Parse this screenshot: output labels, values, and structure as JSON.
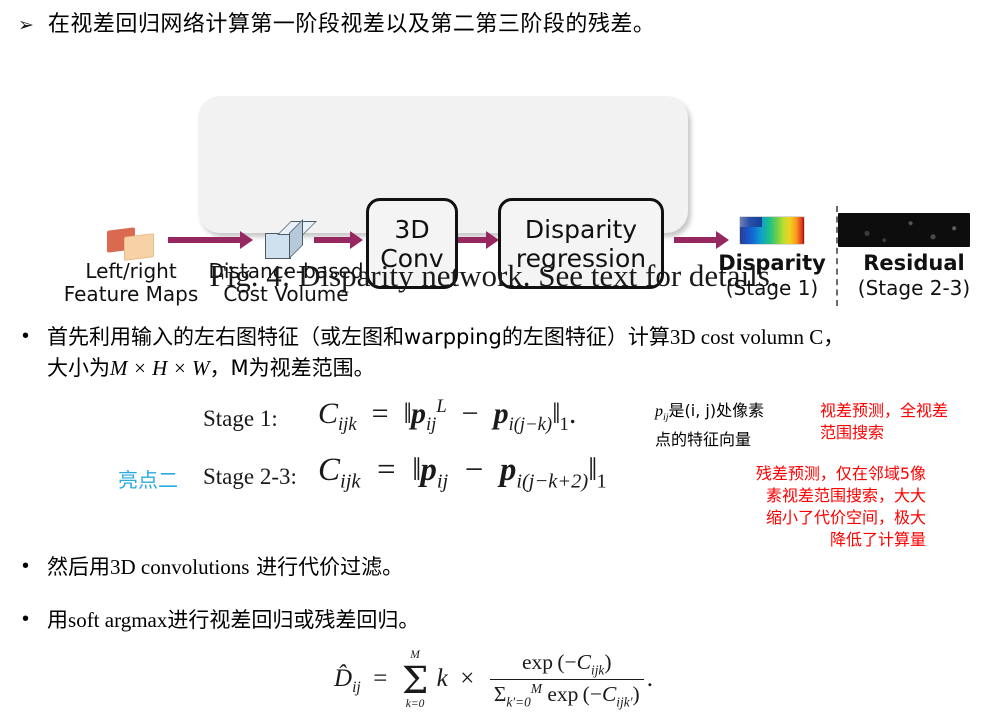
{
  "slide": {
    "heading_bullet_glyph": "➢",
    "heading": "在视差回归网络计算第一阶段视差以及第二第三阶段的残差。"
  },
  "figure": {
    "caption": "Fig. 4: Disparity network. See text for details.",
    "input": {
      "icon": "feature-maps-icon",
      "label_line1": "Left/right",
      "label_line2": "Feature Maps"
    },
    "cost_volume": {
      "icon": "cube-icon",
      "label_line1": "Distance-based",
      "label_line2": "Cost Volume"
    },
    "nodes": [
      {
        "id": "3d-conv",
        "line1": "3D",
        "line2": "Conv"
      },
      {
        "id": "disparity-regression",
        "line1": "Disparity",
        "line2": "regression"
      }
    ],
    "outputs": [
      {
        "id": "disparity",
        "title": "Disparity",
        "stage": "(Stage 1)"
      },
      {
        "id": "residual",
        "title": "Residual",
        "stage": "(Stage 2-3)"
      }
    ],
    "arrow_color": "#96275f",
    "panel_color": "#f2f2f2"
  },
  "bullets": {
    "b1_part1": "首先利用输入的左右图特征（或左图和warpping的左图特征）计算",
    "b1_part2": "3D cost volumn C",
    "b1_part3": "，",
    "b1_line2_a": "大小为",
    "b1_line2_math": "M × H × W",
    "b1_line2_b": "，M为视差范围。",
    "b2_a": "然后用",
    "b2_b": "3D convolutions",
    "b2_c": " 进行代价过滤。",
    "b3_a": "用",
    "b3_b": "soft argmax",
    "b3_c": "进行视差回归或残差回归。",
    "dot": "•"
  },
  "equations": {
    "stage1_label": "Stage 1:",
    "stage23_label": "Stage 2-3:",
    "highlight_tag": "亮点二",
    "stage1_formula_text": "C_ijk = ||p^L_ij − p^R_i(j−k)||_1.",
    "stage23_formula_text": "C_ijk = ||p_ij − p_i(j−k+2)||_1",
    "softargmax_text": "D̂_ij = Σ_{k=0}^{M} k × exp(−C_ijk) / Σ_{k'=0}^{M} exp(−C_ijk')."
  },
  "annotations": {
    "pij_note_line1": "是(i, j)处像素",
    "pij_note_line2": "点的特征向量",
    "pij_symbol": "p",
    "pij_sub": "ij",
    "red_note_1_line1": "视差预测，全视差",
    "red_note_1_line2": "范围搜索",
    "red_note_2_line1": "残差预测，仅在邻域5像",
    "red_note_2_line2": "素视差范围搜索，大大",
    "red_note_2_line3": "缩小了代价空间，极大",
    "red_note_2_line4": "降低了计算量",
    "red_color": "#ff0000",
    "highlight_color": "#29abe2"
  }
}
